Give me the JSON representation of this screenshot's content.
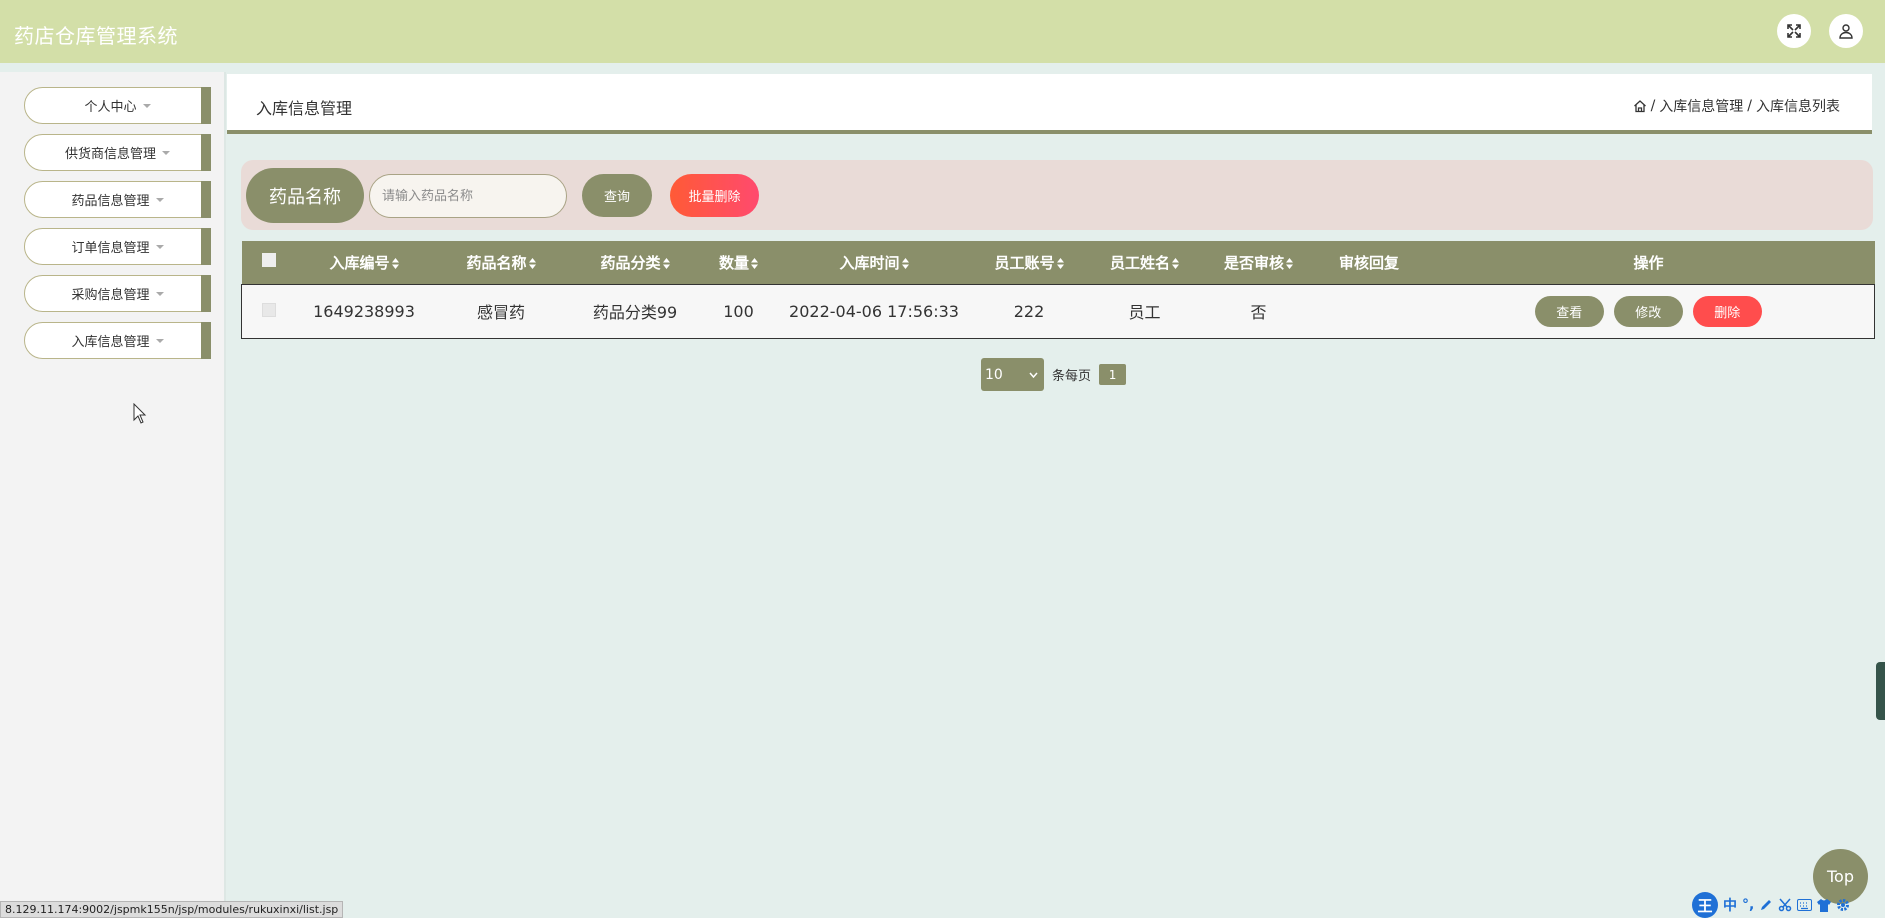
{
  "app": {
    "title": "药店仓库管理系统"
  },
  "header": {
    "fullscreen_icon": "expand-icon",
    "user_icon": "user-icon"
  },
  "sidebar": {
    "items": [
      {
        "label": "个人中心"
      },
      {
        "label": "供货商信息管理"
      },
      {
        "label": "药品信息管理"
      },
      {
        "label": "订单信息管理"
      },
      {
        "label": "采购信息管理"
      },
      {
        "label": "入库信息管理"
      }
    ]
  },
  "page": {
    "title": "入库信息管理",
    "breadcrumb": {
      "level1": "入库信息管理",
      "level2": "入库信息列表",
      "sep": "/"
    }
  },
  "search": {
    "label": "药品名称",
    "placeholder": "请输入药品名称",
    "value": "",
    "query_label": "查询",
    "batch_delete_label": "批量删除"
  },
  "table": {
    "headers": [
      "入库编号",
      "药品名称",
      "药品分类",
      "数量",
      "入库时间",
      "员工账号",
      "员工姓名",
      "是否审核",
      "审核回复",
      "操作"
    ],
    "rows": [
      {
        "code": "1649238993",
        "name": "感冒药",
        "category": "药品分类99",
        "quantity": "100",
        "time": "2022-04-06 17:56:33",
        "account": "222",
        "staff_name": "员工",
        "audited": "否",
        "reply": "",
        "view_label": "查看",
        "edit_label": "修改",
        "delete_label": "删除"
      }
    ]
  },
  "pagination": {
    "page_size": "10",
    "per_page_label": "条每页",
    "current_page": "1"
  },
  "top_button": {
    "label": "Top"
  },
  "status_bar": {
    "url": "8.129.11.174:9002/jspmk155n/jsp/modules/rukuxinxi/list.jsp"
  },
  "ime": {
    "logo": "王",
    "mode": "中",
    "punct": "°,"
  },
  "colors": {
    "primary": "#8a8f6a",
    "header_bg": "#d3dfa8",
    "danger": "#ff4d4d",
    "page_bg": "#e4efec"
  }
}
